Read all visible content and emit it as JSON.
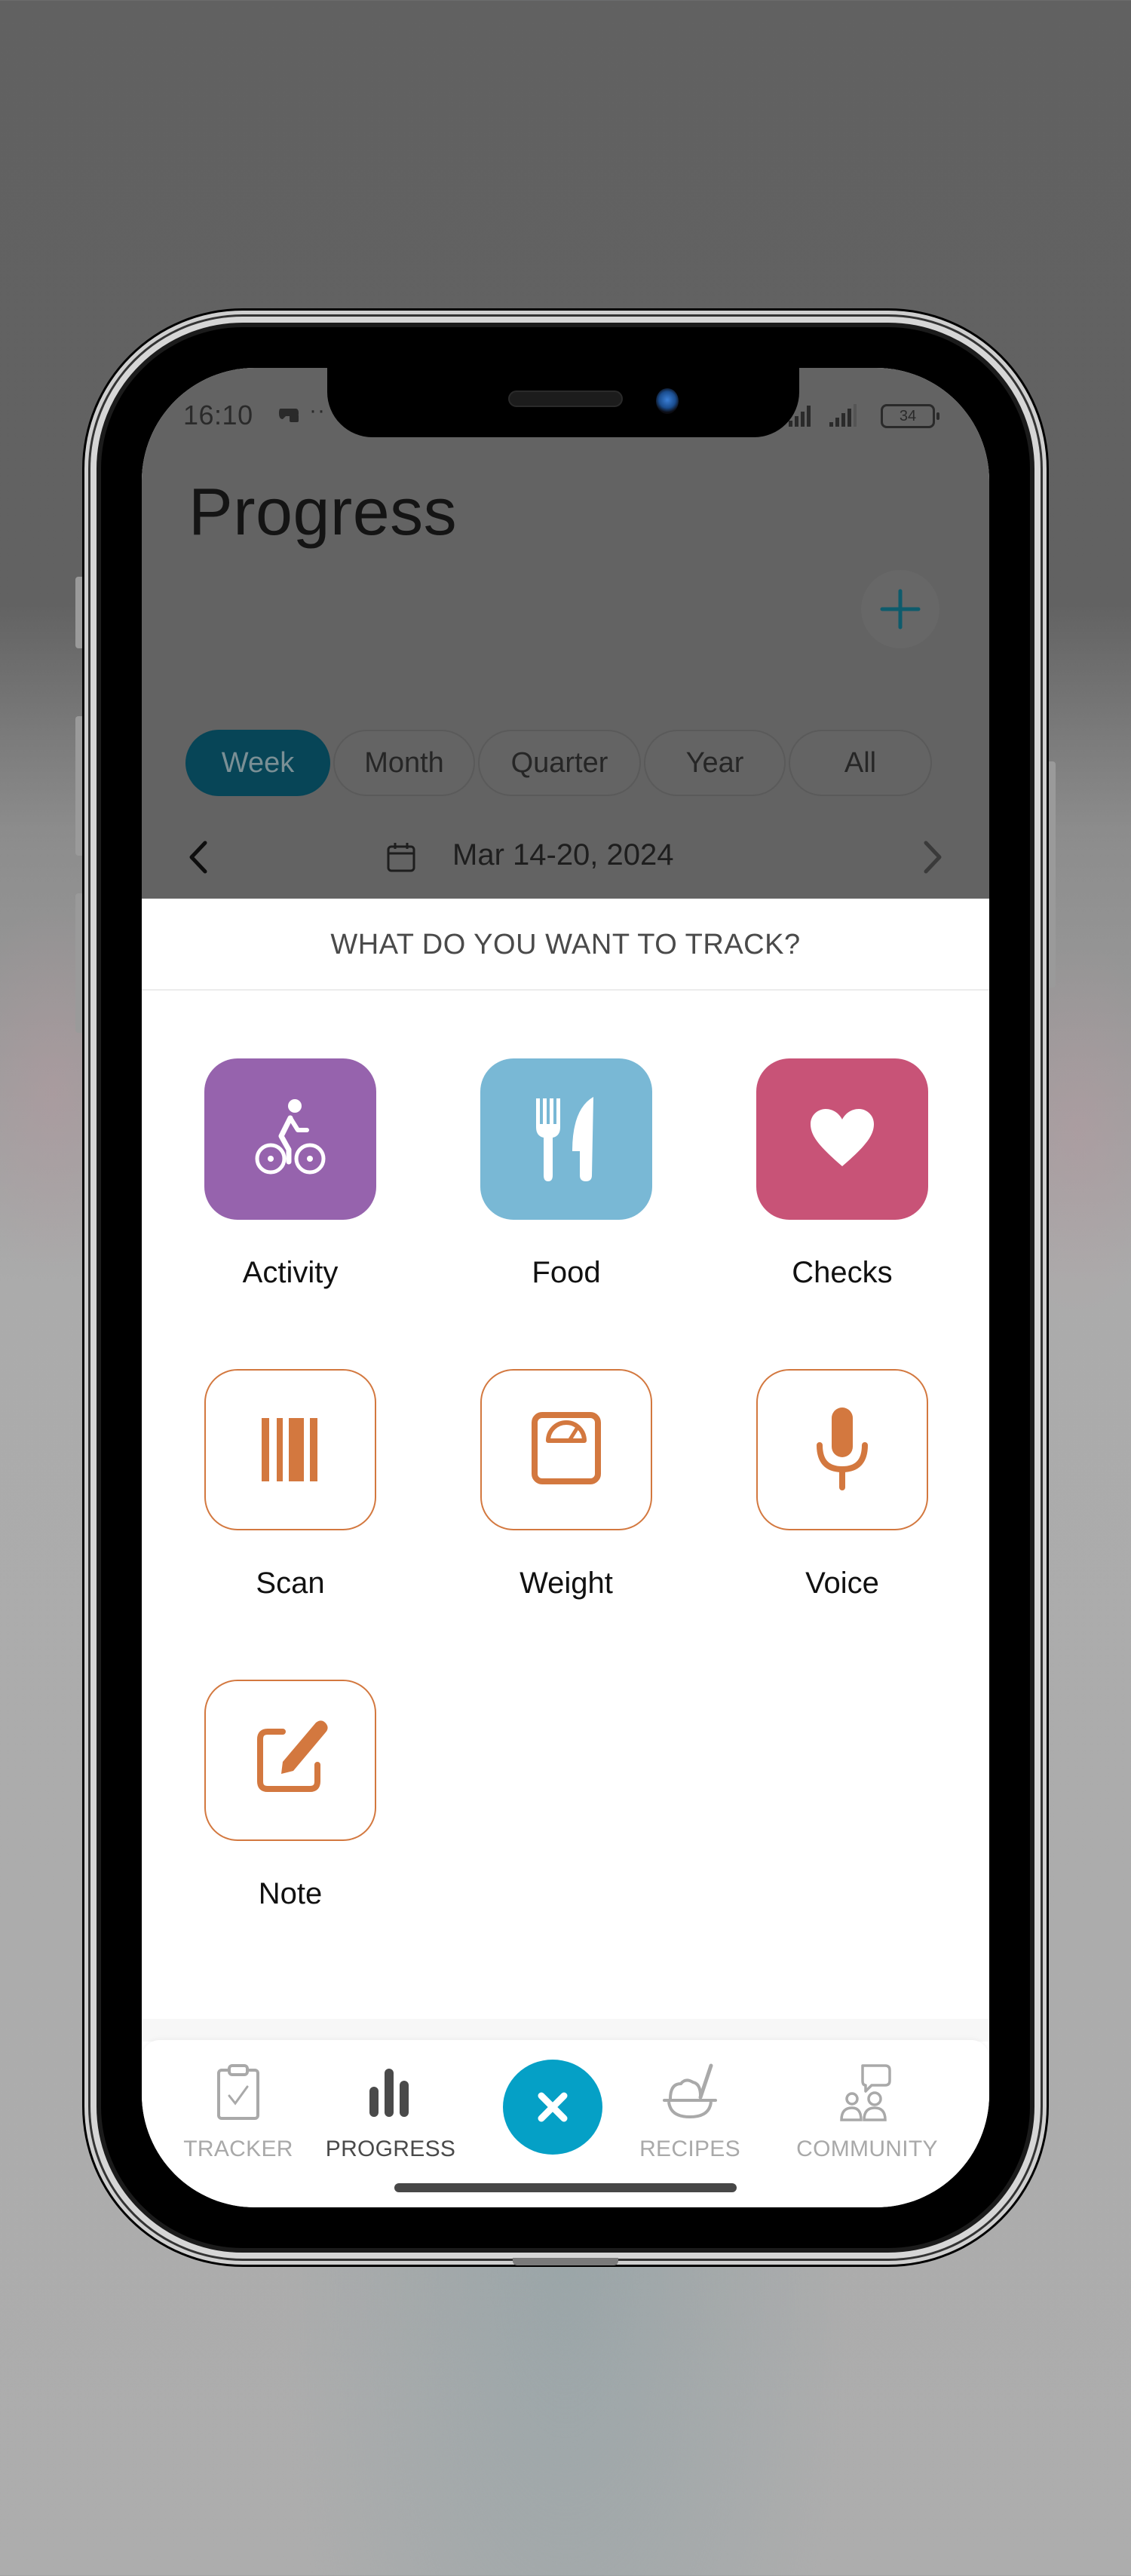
{
  "status_bar": {
    "time": "16:10",
    "dots": "··",
    "battery": "34"
  },
  "header": {
    "title": "Progress",
    "add_icon": "plus-icon"
  },
  "range_tabs": [
    {
      "label": "Week",
      "active": true
    },
    {
      "label": "Month",
      "active": false
    },
    {
      "label": "Quarter",
      "active": false
    },
    {
      "label": "Year",
      "active": false
    },
    {
      "label": "All",
      "active": false
    }
  ],
  "date_nav": {
    "label": "Mar 14-20, 2024",
    "prev_icon": "chevron-left-icon",
    "next_icon": "chevron-right-icon",
    "calendar_icon": "calendar-icon"
  },
  "sheet": {
    "title": "WHAT DO YOU WANT TO TRACK?",
    "options": [
      {
        "label": "Activity",
        "icon": "bicycle-icon",
        "color": "#9663ad",
        "style": "filled"
      },
      {
        "label": "Food",
        "icon": "fork-knife-icon",
        "color": "#79b8d5",
        "style": "filled"
      },
      {
        "label": "Checks",
        "icon": "heart-icon",
        "color": "#c85377",
        "style": "filled"
      },
      {
        "label": "Scan",
        "icon": "barcode-icon",
        "color": "#d3783f",
        "style": "outline"
      },
      {
        "label": "Weight",
        "icon": "scale-icon",
        "color": "#d3783f",
        "style": "outline"
      },
      {
        "label": "Voice",
        "icon": "microphone-icon",
        "color": "#d3783f",
        "style": "outline"
      },
      {
        "label": "Note",
        "icon": "edit-note-icon",
        "color": "#d3783f",
        "style": "outline"
      }
    ]
  },
  "bottom_nav": {
    "items": [
      {
        "label": "TRACKER",
        "icon": "clipboard-check-icon",
        "active": false
      },
      {
        "label": "PROGRESS",
        "icon": "bar-chart-icon",
        "active": true
      },
      {
        "label": "RECIPES",
        "icon": "bowl-spoon-icon",
        "active": false
      },
      {
        "label": "COMMUNITY",
        "icon": "community-icon",
        "active": false
      }
    ],
    "center_button_icon": "close-icon"
  },
  "colors": {
    "accent": "#05a0c6",
    "active_tab": "#074557",
    "outline_orange": "#d3783f"
  }
}
